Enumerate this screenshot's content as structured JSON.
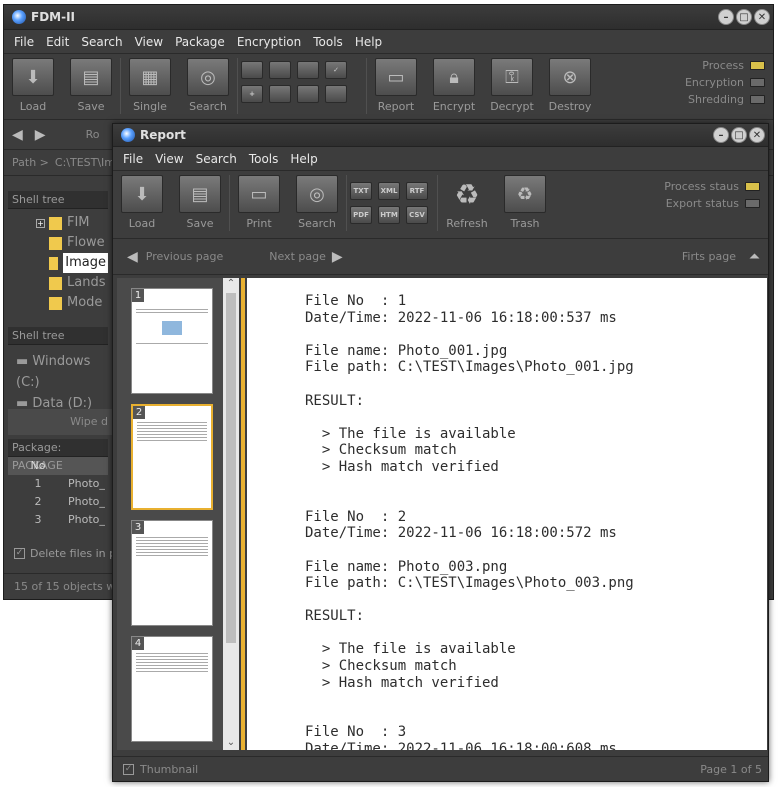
{
  "main": {
    "title": "FDM-II",
    "menu": [
      "File",
      "Edit",
      "Search",
      "View",
      "Package",
      "Encryption",
      "Tools",
      "Help"
    ],
    "toolbar": [
      "Load",
      "Save",
      "Single",
      "Search",
      "Report",
      "Encrypt",
      "Decrypt",
      "Destroy"
    ],
    "status": [
      "Process",
      "Encryption",
      "Shredding"
    ],
    "nav_cut": "Ro",
    "path_label": "Path >",
    "path_value": "C:\\TEST\\Ima",
    "shell_tree1": "Shell tree",
    "tree1": [
      "FIM",
      "Flowe",
      "Image",
      "Lands",
      "Mode"
    ],
    "shell_tree2": "Shell tree",
    "drives": [
      "Windows (C:)",
      "Data (D:)"
    ],
    "wipe": "Wipe d",
    "package": "Package: PACKAGE",
    "col_no": "No",
    "rows": [
      {
        "no": "1",
        "name": "Photo_"
      },
      {
        "no": "2",
        "name": "Photo_"
      },
      {
        "no": "3",
        "name": "Photo_"
      }
    ],
    "delete_files": "Delete files in pa",
    "statusbar": "15 of 15 objects wer"
  },
  "report": {
    "title": "Report",
    "menu": [
      "File",
      "View",
      "Search",
      "Tools",
      "Help"
    ],
    "toolbar": [
      "Load",
      "Save",
      "Print",
      "Search",
      "Refresh",
      "Trash"
    ],
    "formats": [
      "TXT",
      "XML",
      "RTF",
      "PDF",
      "HTM",
      "CSV"
    ],
    "status": [
      "Process staus",
      "Export status"
    ],
    "prev": "Previous page",
    "next": "Next page",
    "first": "Firts page",
    "thumb_nums": [
      "1",
      "2",
      "3",
      "4"
    ],
    "doc_text": "File No  : 1\nDate/Time: 2022-11-06 16:18:00:537 ms\n\nFile name: Photo_001.jpg\nFile path: C:\\TEST\\Images\\Photo_001.jpg\n\nRESULT:\n\n  > The file is available\n  > Checksum match\n  > Hash match verified\n\n\nFile No  : 2\nDate/Time: 2022-11-06 16:18:00:572 ms\n\nFile name: Photo_003.png\nFile path: C:\\TEST\\Images\\Photo_003.png\n\nRESULT:\n\n  > The file is available\n  > Checksum match\n  > Hash match verified\n\n\nFile No  : 3\nDate/Time: 2022-11-06 16:18:00:608 ms",
    "thumbnail_label": "Thumbnail",
    "page_info": "Page 1 of 5"
  },
  "colors": {
    "led_on": "#d8c04a",
    "led_off": "#6a6a6a",
    "accent": "#e8b030"
  }
}
